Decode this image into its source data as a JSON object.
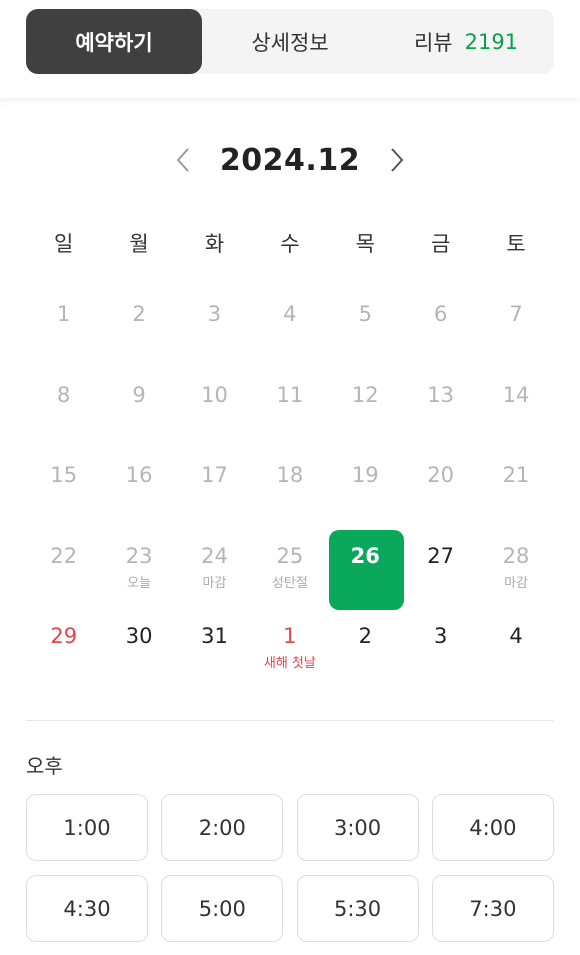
{
  "tabs": [
    {
      "label": "예약하기",
      "active": true
    },
    {
      "label": "상세정보",
      "active": false
    },
    {
      "label": "리뷰",
      "count": "2191",
      "active": false
    }
  ],
  "calendar": {
    "title": "2024.12",
    "weekdays": [
      "일",
      "월",
      "화",
      "수",
      "목",
      "금",
      "토"
    ],
    "weeks": [
      [
        {
          "d": "1",
          "s": "disabled"
        },
        {
          "d": "2",
          "s": "disabled"
        },
        {
          "d": "3",
          "s": "disabled"
        },
        {
          "d": "4",
          "s": "disabled"
        },
        {
          "d": "5",
          "s": "disabled"
        },
        {
          "d": "6",
          "s": "disabled"
        },
        {
          "d": "7",
          "s": "disabled"
        }
      ],
      [
        {
          "d": "8",
          "s": "disabled"
        },
        {
          "d": "9",
          "s": "disabled"
        },
        {
          "d": "10",
          "s": "disabled"
        },
        {
          "d": "11",
          "s": "disabled"
        },
        {
          "d": "12",
          "s": "disabled"
        },
        {
          "d": "13",
          "s": "disabled"
        },
        {
          "d": "14",
          "s": "disabled"
        }
      ],
      [
        {
          "d": "15",
          "s": "disabled"
        },
        {
          "d": "16",
          "s": "disabled"
        },
        {
          "d": "17",
          "s": "disabled"
        },
        {
          "d": "18",
          "s": "disabled"
        },
        {
          "d": "19",
          "s": "disabled"
        },
        {
          "d": "20",
          "s": "disabled"
        },
        {
          "d": "21",
          "s": "disabled"
        }
      ],
      [
        {
          "d": "22",
          "s": "disabled"
        },
        {
          "d": "23",
          "s": "disabled",
          "sub": "오늘"
        },
        {
          "d": "24",
          "s": "disabled",
          "sub": "마감"
        },
        {
          "d": "25",
          "s": "disabled",
          "sub": "성탄절"
        },
        {
          "d": "26",
          "s": "selected"
        },
        {
          "d": "27",
          "s": "avail"
        },
        {
          "d": "28",
          "s": "disabled",
          "sub": "마감"
        }
      ],
      [
        {
          "d": "29",
          "s": "red"
        },
        {
          "d": "30",
          "s": "avail"
        },
        {
          "d": "31",
          "s": "avail"
        },
        {
          "d": "1",
          "s": "red",
          "sub": "새해 첫날"
        },
        {
          "d": "2",
          "s": "avail"
        },
        {
          "d": "3",
          "s": "avail"
        },
        {
          "d": "4",
          "s": "avail"
        }
      ]
    ]
  },
  "period_label": "오후",
  "times": [
    "1:00",
    "2:00",
    "3:00",
    "4:00",
    "4:30",
    "5:00",
    "5:30",
    "7:30"
  ],
  "colors": {
    "accent": "#0aa85a",
    "holiday": "#e2474b",
    "active_tab": "#404040"
  }
}
